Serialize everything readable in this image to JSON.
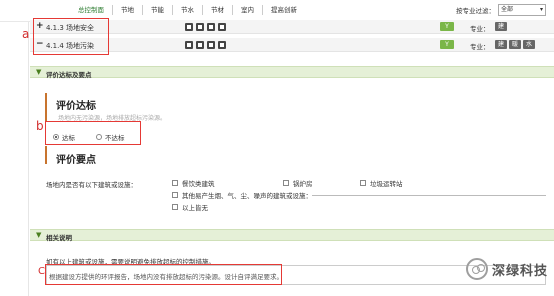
{
  "topnav": {
    "tabs": [
      {
        "label": "总控制面",
        "active": true
      },
      {
        "label": "节地",
        "active": false
      },
      {
        "label": "节能",
        "active": false
      },
      {
        "label": "节水",
        "active": false
      },
      {
        "label": "节材",
        "active": false
      },
      {
        "label": "室内",
        "active": false
      },
      {
        "label": "提高创新",
        "active": false
      }
    ],
    "filter_label": "按专业过滤：",
    "filter_value": "全部"
  },
  "rows": [
    {
      "toggle": "+",
      "title": "4.1.3 场地安全",
      "badge": "Y",
      "prof_label": "专业：",
      "tags": [
        "建"
      ]
    },
    {
      "toggle": "−",
      "title": "4.1.4 场地污染",
      "badge": "Y",
      "prof_label": "专业：",
      "tags": [
        "建",
        "暖",
        "水"
      ]
    }
  ],
  "panel_eval": {
    "chevron": "▼",
    "title": "评价达标及要点"
  },
  "eval": {
    "heading": "评价达标",
    "hint": "场地内无污染源，场地排放超标污染源。",
    "options": [
      {
        "label": "达标",
        "checked": true
      },
      {
        "label": "不达标",
        "checked": false
      }
    ],
    "points_heading": "评价要点",
    "question": "场地内是否有以下建筑或设施：",
    "checkboxes": [
      {
        "label": "餐饮类建筑"
      },
      {
        "label": "锅炉房"
      },
      {
        "label": "垃圾运转站"
      },
      {
        "label": "其他易产生烟、气、尘、噪声的建筑或设施："
      },
      {
        "label": "以上皆无"
      }
    ]
  },
  "panel_note": {
    "chevron": "▼",
    "title": "相关说明"
  },
  "note": {
    "text": "如有以上建筑或设施，需要说明避免排放超标的控制措施。",
    "box_text": "根据建设方提供的环评报告，场地内没有排放超标的污染源。设计自评满足要求。"
  },
  "annotations": {
    "a": "a",
    "b": "b",
    "c": "C"
  },
  "watermark": {
    "text": "深绿科技"
  }
}
